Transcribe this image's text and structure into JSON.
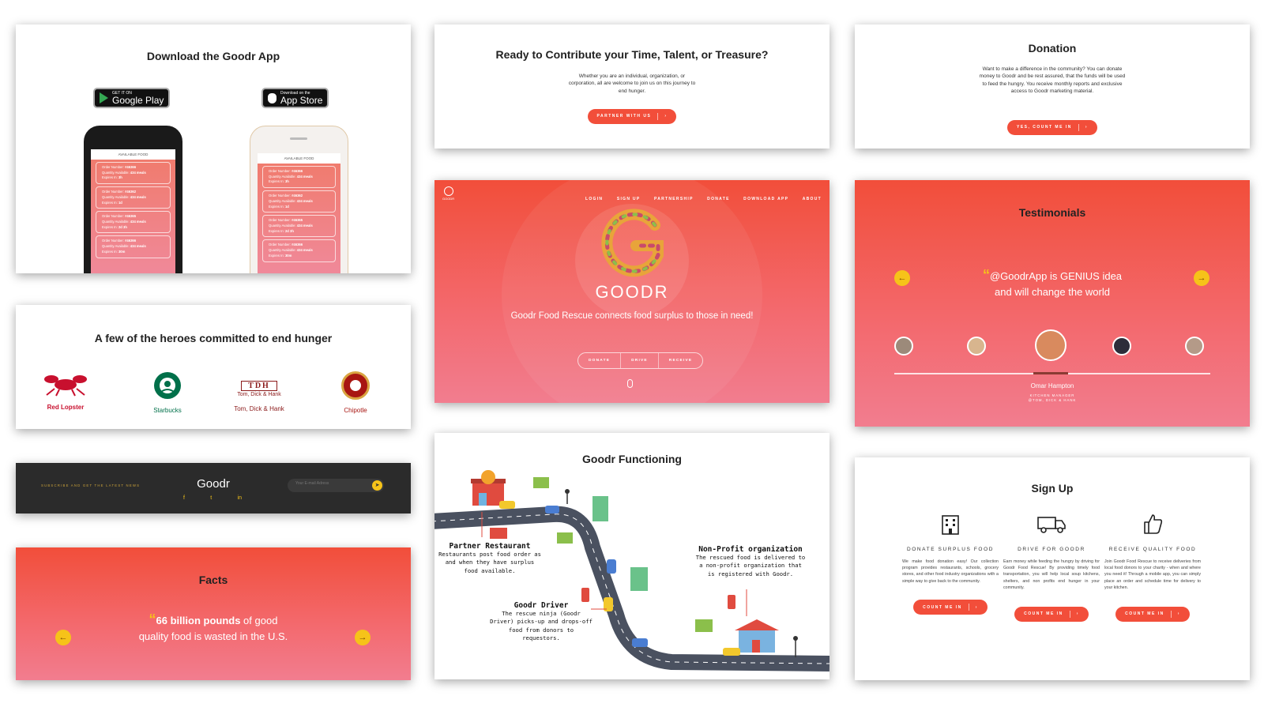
{
  "download": {
    "title": "Download the Goodr App",
    "google": {
      "small": "GET IT ON",
      "big": "Google Play"
    },
    "apple": {
      "small": "Download on the",
      "big": "App Store"
    },
    "screen_title": "AVAILABLE FOOD",
    "orders_left": [
      {
        "number": "#46366",
        "qty": "434 meals",
        "expires": "3h"
      },
      {
        "number": "#46362",
        "qty": "434 meals",
        "expires": "1d"
      },
      {
        "number": "#46365",
        "qty": "434 meals",
        "expires": "2d 3h"
      },
      {
        "number": "#46366",
        "qty": "434 meals",
        "expires": "30m"
      }
    ],
    "orders_right": [
      {
        "number": "#46366",
        "qty": "434 meals",
        "expires": "3h"
      },
      {
        "number": "#46362",
        "qty": "434 meals",
        "expires": "1d"
      },
      {
        "number": "#46365",
        "qty": "434 meals",
        "expires": "2d 3h"
      },
      {
        "number": "#46366",
        "qty": "434 meals",
        "expires": "30m"
      }
    ],
    "labels": {
      "order": "Order Number:",
      "qty": "Quantity Available:",
      "exp": "Expires In:"
    }
  },
  "contribute": {
    "title": "Ready to Contribute your Time, Talent, or Treasure?",
    "text": "Whether you are an individual, organization, or corporation, all are welcome to join us on this journey to end hunger.",
    "button": "PARTNER WITH US"
  },
  "donation": {
    "title": "Donation",
    "text": "Want to make a difference in the community? You can donate money to Goodr and be rest assured, that the funds will be used to feed the hungry. You receive monthly reports and exclusive access to Goodr marketing material.",
    "button": "YES, COUNT ME IN"
  },
  "heroes": {
    "title": "A few of the heroes committed to end hunger",
    "logos": [
      {
        "label": "Red Lopster",
        "color": "#c8102e"
      },
      {
        "label": "Starbucks",
        "color": "#00704a"
      },
      {
        "label": "Tom, Dick & Hank",
        "color": "#8b1a1a"
      },
      {
        "label": "Chipotle",
        "color": "#a81612"
      }
    ],
    "tdh_mark": "TDH",
    "tdh_name": "Tom, Dick & Hank",
    "chipotle_mark": "CHIPOTLE"
  },
  "hero_section": {
    "logo_small": "GOODR",
    "nav": [
      "LOGIN",
      "SIGN UP",
      "PARTNERSHIP",
      "DONATE",
      "DOWNLOAD APP",
      "ABOUT"
    ],
    "brand": "GOODR",
    "tagline": "Goodr Food Rescue connects food surplus to those in need!",
    "segments": [
      "DONATE",
      "DRIVE",
      "RECEIVE"
    ]
  },
  "testimonials": {
    "title": "Testimonials",
    "quote": "@GoodrApp is GENIUS idea and will change the world",
    "name": "Omar Hampton",
    "role": "KITCHEN MANAGER",
    "company": "@TOM, DICK & HANK"
  },
  "newsletter": {
    "label": "SUBSCRIBE AND GET THE LATEST NEWS",
    "brand": "Goodr",
    "placeholder": "Your E-mail Adress",
    "social": [
      "f",
      "t",
      "in"
    ]
  },
  "functioning": {
    "title": "Goodr Functioning",
    "partner_title": "Partner Restaurant",
    "partner_text": "Restaurants post food order as and when they have surplus food available.",
    "driver_title": "Goodr Driver",
    "driver_text": "The rescue ninja (Goodr Driver) picks-up and drops-off food from donors to requestors.",
    "nonprofit_title": "Non-Profit organization",
    "nonprofit_text": "The rescued food is delivered to a non-profit organization that is registered with Goodr."
  },
  "facts": {
    "title": "Facts",
    "highlight": "66 billion pounds",
    "rest": " of good quality food is wasted in the U.S."
  },
  "signup": {
    "title": "Sign Up",
    "columns": [
      {
        "icon": "building-icon",
        "title": "DONATE SURPLUS FOOD",
        "text": "We make food donation easy! Our collection program provides restaurants, schools, grocery stores, and other food industry organizations with a simple way to give back to the community.",
        "button": "COUNT ME IN"
      },
      {
        "icon": "truck-icon",
        "title": "DRIVE FOR GOODR",
        "text": "Earn money while feeding the hungry by driving for Goodr Food Rescue! By providing timely food transportation, you will help local soup kitchens, shelters, and non profits end hunger in your community.",
        "button": "COUNT ME IN"
      },
      {
        "icon": "thumbs-up-icon",
        "title": "RECEIVE QUALITY FOOD",
        "text": "Join Goodr Food Rescue to receive deliveries from local food donors to your charity - when and where you need it! Through a mobile app, you can simply place an order and schedule time for delivery to your kitchen.",
        "button": "COUNT ME IN"
      }
    ]
  },
  "colors": {
    "accent": "#f24e3a",
    "yellow": "#f6c319",
    "dark": "#2b2b2b"
  }
}
